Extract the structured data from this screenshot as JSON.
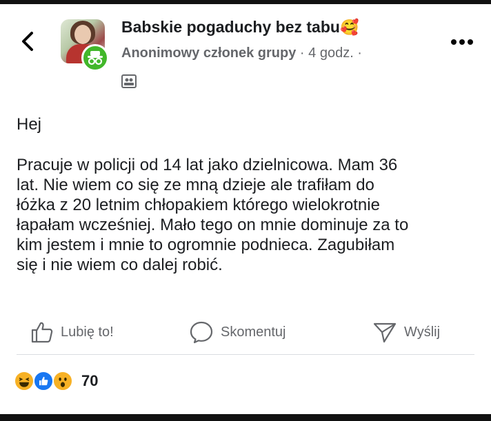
{
  "header": {
    "group_name": "Babskie pogaduchy bez tabu",
    "group_emoji": "🥰",
    "author": "Anonimowy członek grupy",
    "separator": " · ",
    "time": "4 godz.",
    "time_suffix": " ·"
  },
  "post": {
    "greeting": "Hej",
    "body_lines": [
      "Pracuje w policji od 14 lat jako dzielnicowa. Mam 36",
      "lat. Nie wiem co się ze mną dzieje ale trafiłam do",
      "łóżka z 20 letnim chłopakiem którego wielokrotnie",
      "łapałam wcześniej. Mało tego on mnie dominuje za to",
      "kim jestem i mnie to ogromnie podnieca. Zagubiłam",
      "się i nie wiem co dalej robić."
    ]
  },
  "actions": {
    "like_label": "Lubię to!",
    "comment_label": "Skomentuj",
    "share_label": "Wyślij"
  },
  "reactions": {
    "icons": [
      "haha-icon",
      "like-icon",
      "wow-icon"
    ],
    "count": "70"
  },
  "colors": {
    "text": "#1c1e21",
    "secondary": "#65676b",
    "like_blue": "#1877f2",
    "anon_green": "#42b72a",
    "reaction_yellow": "#f7b125"
  }
}
